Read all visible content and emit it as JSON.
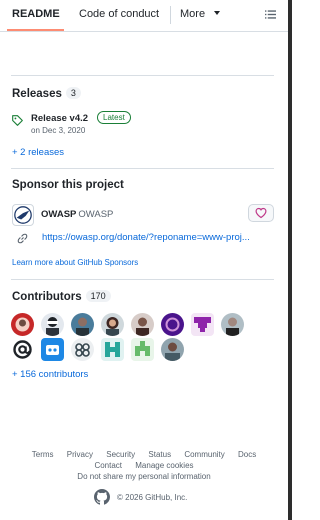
{
  "tabs": {
    "readme": "README",
    "code_of_conduct": "Code of conduct",
    "more": "More"
  },
  "releases": {
    "heading": "Releases",
    "count": "3",
    "latest_name": "Release v4.2",
    "latest_badge": "Latest",
    "latest_date": "on Dec 3, 2020",
    "more_link": "+ 2 releases"
  },
  "sponsor": {
    "heading": "Sponsor this project",
    "account_bold": "OWASP",
    "account_name": "OWASP",
    "donate_url": "https://owasp.org/donate/?reponame=www-proj...",
    "learn_more": "Learn more about GitHub Sponsors"
  },
  "contributors": {
    "heading": "Contributors",
    "count": "170",
    "more_link": "+ 156 contributors"
  },
  "footer": {
    "row1": [
      "Terms",
      "Privacy",
      "Security",
      "Status",
      "Community",
      "Docs"
    ],
    "row2": [
      "Contact",
      "Manage cookies"
    ],
    "row3": "Do not share my personal information",
    "copyright": "© 2026 GitHub, Inc."
  },
  "colors": {
    "accent_link": "#0969da",
    "tab_underline": "#fd8c73",
    "latest_green": "#1a7f37",
    "heart_pink": "#bf3989"
  }
}
